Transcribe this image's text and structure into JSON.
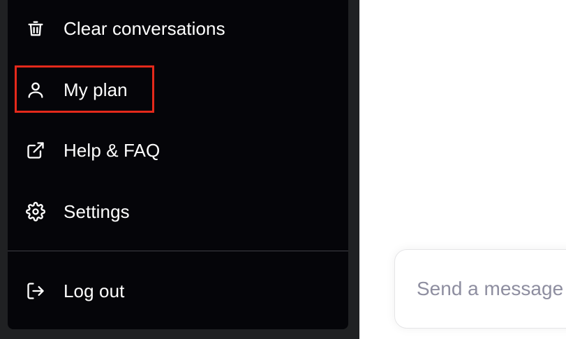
{
  "menu": {
    "items": [
      {
        "name": "clear-conversations",
        "label": "Clear conversations",
        "icon": "trash-icon"
      },
      {
        "name": "my-plan",
        "label": "My plan",
        "icon": "user-icon"
      },
      {
        "name": "help-faq",
        "label": "Help & FAQ",
        "icon": "external-link-icon"
      },
      {
        "name": "settings",
        "label": "Settings",
        "icon": "gear-icon"
      }
    ],
    "logout": {
      "label": "Log out",
      "icon": "logout-icon"
    }
  },
  "composer": {
    "placeholder": "Send a message"
  },
  "colors": {
    "sidebar_bg": "#202123",
    "menu_bg": "#050509",
    "highlight": "#e5291b",
    "placeholder": "#8e8ea0"
  }
}
